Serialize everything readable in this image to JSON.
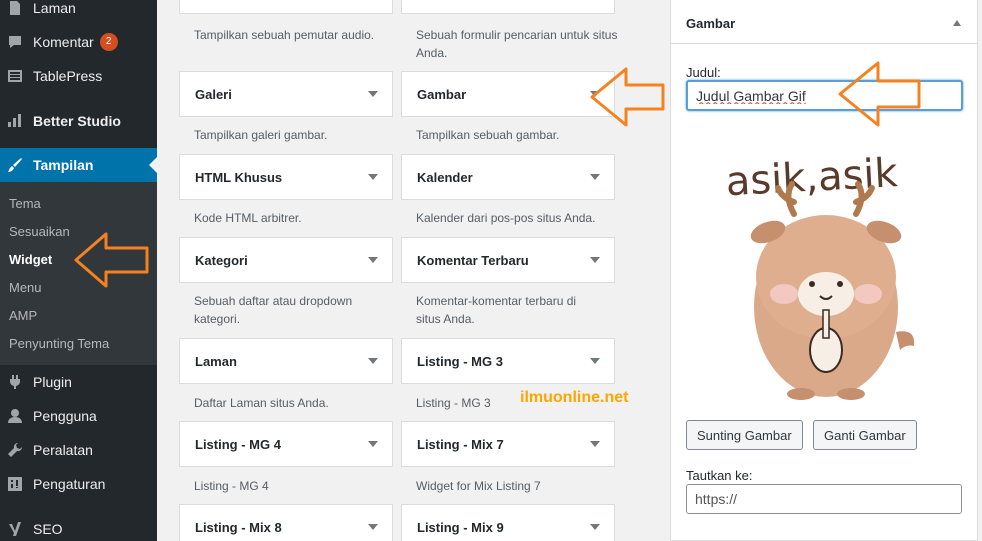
{
  "sidebar": {
    "items": [
      {
        "id": "laman",
        "label": "Laman",
        "icon": "page-icon"
      },
      {
        "id": "komentar",
        "label": "Komentar",
        "icon": "comment-icon",
        "badge": "2"
      },
      {
        "id": "tablepress",
        "label": "TablePress",
        "icon": "table-icon"
      },
      {
        "id": "better-studio",
        "label": "Better Studio",
        "icon": "chart-icon"
      },
      {
        "id": "tampilan",
        "label": "Tampilan",
        "icon": "brush-icon"
      },
      {
        "id": "plugin",
        "label": "Plugin",
        "icon": "plugin-icon"
      },
      {
        "id": "pengguna",
        "label": "Pengguna",
        "icon": "user-icon"
      },
      {
        "id": "peralatan",
        "label": "Peralatan",
        "icon": "wrench-icon"
      },
      {
        "id": "pengaturan",
        "label": "Pengaturan",
        "icon": "settings-icon"
      },
      {
        "id": "seo",
        "label": "SEO",
        "icon": "yoast-icon"
      }
    ],
    "submenu": [
      "Tema",
      "Sesuaikan",
      "Widget",
      "Menu",
      "AMP",
      "Penyunting Tema"
    ],
    "current_submenu": "Widget",
    "active_color": "#0073aa"
  },
  "widgets": {
    "top_desc_left": "Tampilkan sebuah pemutar audio.",
    "top_desc_right": "Sebuah formulir pencarian untuk situs Anda.",
    "items": [
      {
        "title": "Galeri",
        "desc": "Tampilkan galeri gambar."
      },
      {
        "title": "Gambar",
        "desc": "Tampilkan sebuah gambar."
      },
      {
        "title": "HTML Khusus",
        "desc": "Kode HTML arbitrer."
      },
      {
        "title": "Kalender",
        "desc": "Kalender dari pos-pos situs Anda."
      },
      {
        "title": "Kategori",
        "desc": "Sebuah daftar atau dropdown kategori."
      },
      {
        "title": "Komentar Terbaru",
        "desc": "Komentar-komentar terbaru di situs Anda."
      },
      {
        "title": "Laman",
        "desc": "Daftar Laman situs Anda."
      },
      {
        "title": "Listing - MG 3",
        "desc": "Listing - MG 3"
      },
      {
        "title": "Listing - MG 4",
        "desc": "Listing - MG 4"
      },
      {
        "title": "Listing - Mix 7",
        "desc": "Widget for Mix Listing 7"
      },
      {
        "title": "Listing - Mix 8",
        "desc": ""
      },
      {
        "title": "Listing - Mix 9",
        "desc": ""
      }
    ]
  },
  "panel": {
    "title": "Gambar",
    "judul_label": "Judul:",
    "judul_value": "Judul Gambar Gif",
    "image_text": "asik,asik",
    "edit_button": "Sunting Gambar",
    "replace_button": "Ganti Gambar",
    "link_label": "Tautkan ke:",
    "link_value": "https://"
  },
  "watermark": "ilmuonline.net",
  "colors": {
    "arrow": "#f58220",
    "badge": "#d54e21",
    "watermark": "#ffa500"
  }
}
